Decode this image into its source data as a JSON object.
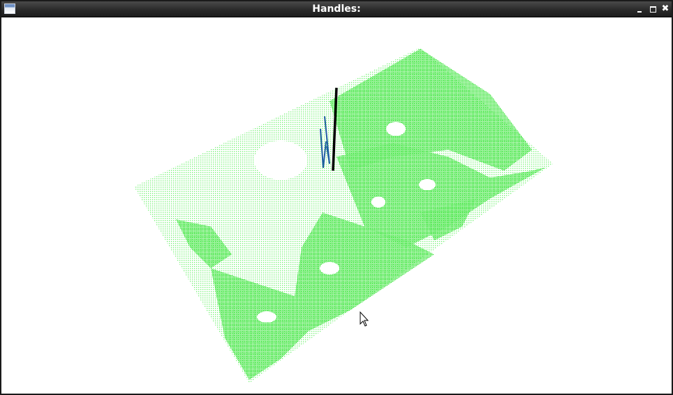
{
  "window": {
    "title": "Handles:"
  },
  "controls": {
    "minimize_icon": "minimize-icon",
    "maximize_icon": "maximize-icon",
    "close_icon": "close-icon",
    "close_glyph": "✖"
  },
  "scene": {
    "point_cloud_color": "#00ee00",
    "handle_color": "#000000",
    "gripper_color": "#1f5fa0",
    "cursor_icon": "mouse-pointer-icon"
  }
}
